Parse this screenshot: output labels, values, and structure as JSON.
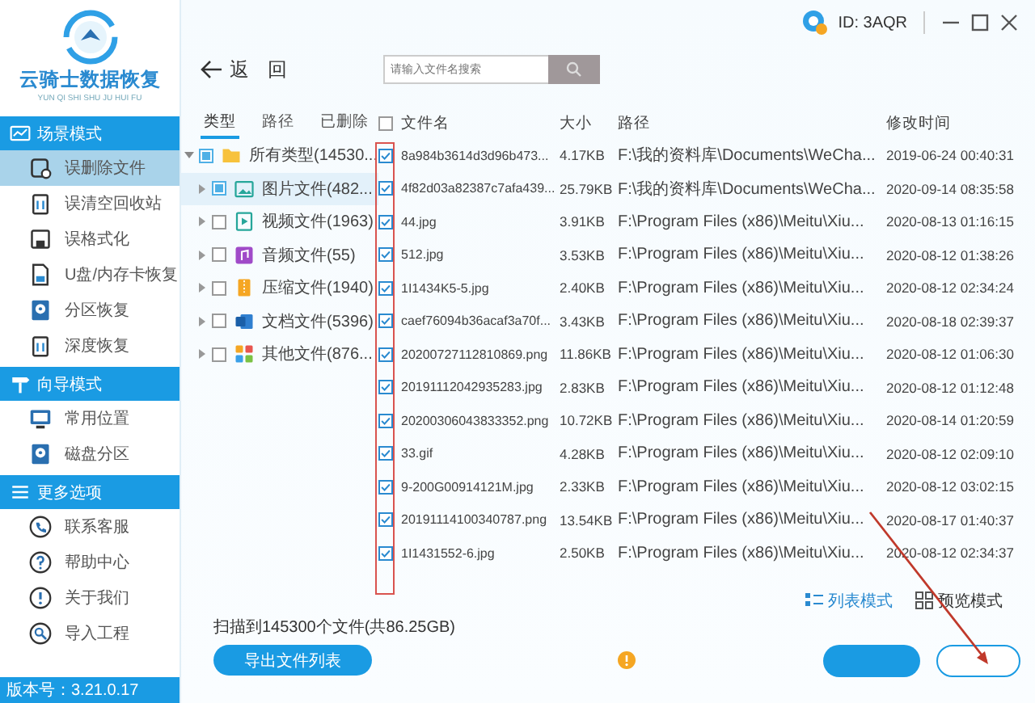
{
  "app": {
    "name": "云骑士数据恢复",
    "subtitle": "YUN QI SHI SHU JU HUI FU",
    "version": "版本号：3.21.0.17"
  },
  "sidebar": {
    "sections": [
      {
        "title": "场景模式",
        "kind": "wave",
        "items": [
          {
            "label": "误删除文件",
            "kind": "file",
            "selected": true
          },
          {
            "label": "误清空回收站",
            "kind": "trash",
            "selected": false
          },
          {
            "label": "误格式化",
            "kind": "floppy",
            "selected": false
          },
          {
            "label": "U盘/内存卡恢复",
            "kind": "card",
            "selected": false
          },
          {
            "label": "分区恢复",
            "kind": "disk",
            "selected": false
          },
          {
            "label": "深度恢复",
            "kind": "trash",
            "selected": false
          }
        ]
      },
      {
        "title": "向导模式",
        "kind": "sign",
        "items": [
          {
            "label": "常用位置",
            "kind": "monitor",
            "selected": false
          },
          {
            "label": "磁盘分区",
            "kind": "disk",
            "selected": false
          }
        ]
      },
      {
        "title": "更多选项",
        "kind": "menu",
        "items": [
          {
            "label": "联系客服",
            "kind": "phone",
            "selected": false
          },
          {
            "label": "帮助中心",
            "kind": "question",
            "selected": false
          },
          {
            "label": "关于我们",
            "kind": "exclaim",
            "selected": false
          },
          {
            "label": "导入工程",
            "kind": "import",
            "selected": false
          }
        ]
      }
    ]
  },
  "header": {
    "user_id": "ID: 3AQR",
    "back": "返 回",
    "search": {
      "placeholder": "请输入文件名搜索"
    }
  },
  "tabs": [
    {
      "label": "类型",
      "selected": true
    },
    {
      "label": "路径",
      "selected": false
    },
    {
      "label": "已删除",
      "selected": false
    }
  ],
  "tree": {
    "label": "所有类型(14530...",
    "kind": "folder",
    "checked": false,
    "indeterminate": true,
    "expanded": true,
    "selected": false,
    "children": [
      {
        "label": "图片文件(482...",
        "kind": "image",
        "checked": false,
        "indeterminate": true,
        "expanded": false,
        "selected": true
      },
      {
        "label": "视频文件(1963)",
        "kind": "video",
        "checked": false,
        "indeterminate": false,
        "expanded": false,
        "selected": false
      },
      {
        "label": "音频文件(55)",
        "kind": "audio",
        "checked": false,
        "indeterminate": false,
        "expanded": false,
        "selected": false
      },
      {
        "label": "压缩文件(1940)",
        "kind": "archive",
        "checked": false,
        "indeterminate": false,
        "expanded": false,
        "selected": false
      },
      {
        "label": "文档文件(5396)",
        "kind": "document",
        "checked": false,
        "indeterminate": false,
        "expanded": false,
        "selected": false
      },
      {
        "label": "其他文件(876...",
        "kind": "other",
        "checked": false,
        "indeterminate": false,
        "expanded": false,
        "selected": false
      }
    ]
  },
  "table": {
    "select_all": false,
    "columns": [
      "文件名",
      "大小",
      "路径",
      "修改时间"
    ],
    "rows": [
      {
        "checked": true,
        "name": "8a984b3614d3d96b473...",
        "size": "4.17KB",
        "path": "F:\\我的资料库\\Documents\\WeCha...",
        "modified": "2019-06-24 00:40:31"
      },
      {
        "checked": true,
        "name": "4f82d03a82387c7afa439...",
        "size": "25.79KB",
        "path": "F:\\我的资料库\\Documents\\WeCha...",
        "modified": "2020-09-14 08:35:58"
      },
      {
        "checked": true,
        "name": "44.jpg",
        "size": "3.91KB",
        "path": "F:\\Program Files (x86)\\Meitu\\Xiu...",
        "modified": "2020-08-13 01:16:15"
      },
      {
        "checked": true,
        "name": "512.jpg",
        "size": "3.53KB",
        "path": "F:\\Program Files (x86)\\Meitu\\Xiu...",
        "modified": "2020-08-12 01:38:26"
      },
      {
        "checked": true,
        "name": "1I1434K5-5.jpg",
        "size": "2.40KB",
        "path": "F:\\Program Files (x86)\\Meitu\\Xiu...",
        "modified": "2020-08-12 02:34:24"
      },
      {
        "checked": true,
        "name": "caef76094b36acaf3a70f...",
        "size": "3.43KB",
        "path": "F:\\Program Files (x86)\\Meitu\\Xiu...",
        "modified": "2020-08-18 02:39:37"
      },
      {
        "checked": true,
        "name": "20200727112810869.png",
        "size": "11.86KB",
        "path": "F:\\Program Files (x86)\\Meitu\\Xiu...",
        "modified": "2020-08-12 01:06:30"
      },
      {
        "checked": true,
        "name": "20191112042935283.jpg",
        "size": "2.83KB",
        "path": "F:\\Program Files (x86)\\Meitu\\Xiu...",
        "modified": "2020-08-12 01:12:48"
      },
      {
        "checked": true,
        "name": "20200306043833352.png",
        "size": "10.72KB",
        "path": "F:\\Program Files (x86)\\Meitu\\Xiu...",
        "modified": "2020-08-14 01:20:59"
      },
      {
        "checked": true,
        "name": "33.gif",
        "size": "4.28KB",
        "path": "F:\\Program Files (x86)\\Meitu\\Xiu...",
        "modified": "2020-08-12 02:09:10"
      },
      {
        "checked": true,
        "name": "9-200G00914121M.jpg",
        "size": "2.33KB",
        "path": "F:\\Program Files (x86)\\Meitu\\Xiu...",
        "modified": "2020-08-12 03:02:15"
      },
      {
        "checked": true,
        "name": "20191114100340787.png",
        "size": "13.54KB",
        "path": "F:\\Program Files (x86)\\Meitu\\Xiu...",
        "modified": "2020-08-17 01:40:37"
      },
      {
        "checked": true,
        "name": "1I1431552-6.jpg",
        "size": "2.50KB",
        "path": "F:\\Program Files (x86)\\Meitu\\Xiu...",
        "modified": "2020-08-12 02:34:37"
      }
    ]
  },
  "view_modes": [
    {
      "label": "列表模式",
      "kind": "list",
      "selected": true
    },
    {
      "label": "预览模式",
      "kind": "grid",
      "selected": false
    }
  ],
  "status": "扫描到145300个文件(共86.25GB)",
  "export_button": "导出文件列表"
}
